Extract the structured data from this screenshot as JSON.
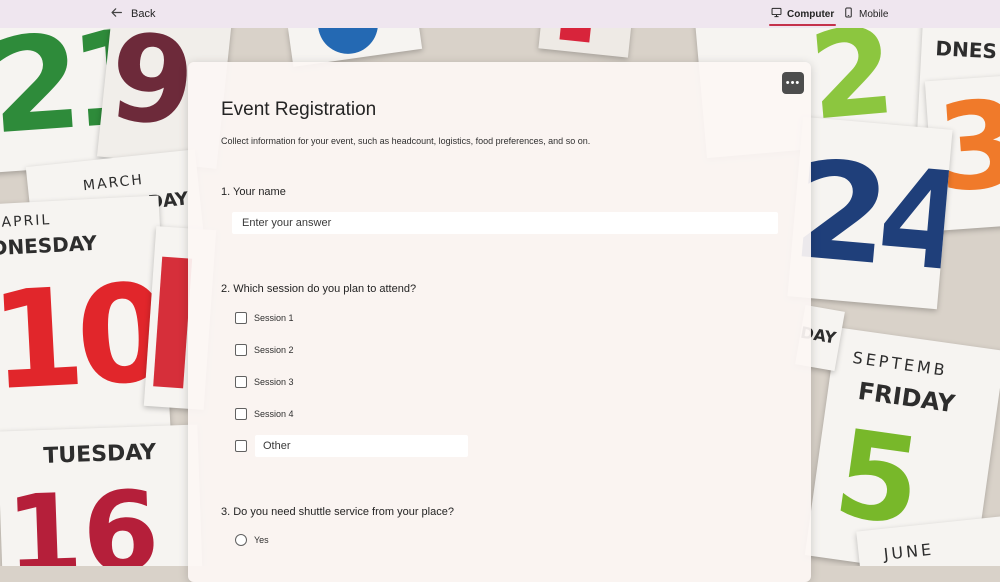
{
  "topbar": {
    "back_label": "Back",
    "view_computer": "Computer",
    "view_mobile": "Mobile"
  },
  "background": {
    "left_cards": [
      {
        "number": "21",
        "color": "#2e8b3a"
      },
      {
        "number": "9",
        "color": "#6d2a3a"
      },
      {
        "month": "MARCH",
        "day": "DAY"
      },
      {
        "month": "APRIL",
        "day": "DNESDAY",
        "number": "10",
        "color": "#e1262b"
      },
      {
        "day": "TUESDAY"
      },
      {
        "number": "16",
        "color": "#b51f3a"
      }
    ],
    "right_cards": [
      {
        "number": "2",
        "color": "#8cc63f"
      },
      {
        "day": "DNES"
      },
      {
        "number": "3",
        "color": "#f07a2a"
      },
      {
        "number": "24",
        "color": "#1f3f7a"
      },
      {
        "month": "SEPTEMB",
        "day": "FRIDAY",
        "number": "5",
        "color": "#78b82a"
      },
      {
        "month": "JUNE"
      },
      {
        "day": "DAY"
      }
    ]
  },
  "form": {
    "more_icon": "more-horizontal-icon",
    "title": "Event Registration",
    "description": "Collect information for your event, such as headcount, logistics, food preferences, and so on.",
    "questions": [
      {
        "label": "1. Your name",
        "placeholder": "Enter your answer"
      },
      {
        "label": "2. Which session do you plan to attend?",
        "options": [
          "Session 1",
          "Session 2",
          "Session 3",
          "Session 4"
        ],
        "other_placeholder": "Other"
      },
      {
        "label": "3. Do you need shuttle service from your place?",
        "options": [
          "Yes"
        ]
      }
    ]
  }
}
